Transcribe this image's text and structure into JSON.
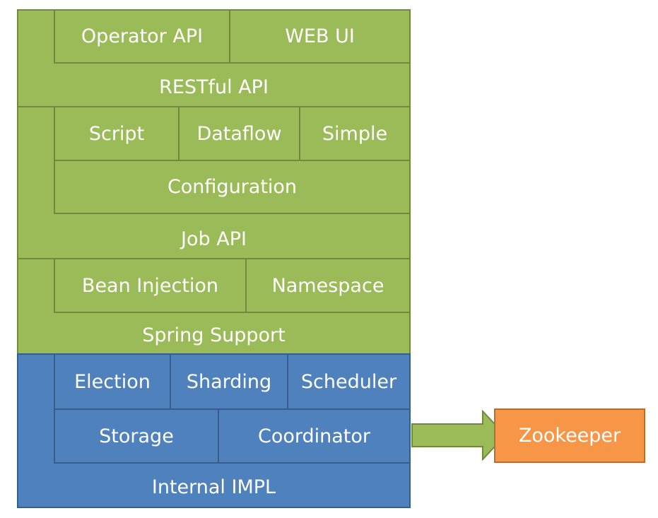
{
  "layers": {
    "restful": {
      "label": "RESTful API",
      "items": [
        "Operator API",
        "WEB UI"
      ]
    },
    "job": {
      "label": "Job API",
      "items": [
        "Script",
        "Dataflow",
        "Simple"
      ],
      "configuration": "Configuration"
    },
    "spring": {
      "label": "Spring Support",
      "items": [
        "Bean Injection",
        "Namespace"
      ]
    },
    "internal": {
      "label": "Internal IMPL",
      "items": [
        "Election",
        "Sharding",
        "Scheduler"
      ],
      "items2": [
        "Storage",
        "Coordinator"
      ]
    }
  },
  "external": {
    "label": "Zookeeper"
  },
  "colors": {
    "green": "#9bbb59",
    "blue": "#4f81bd",
    "orange": "#f79646"
  }
}
